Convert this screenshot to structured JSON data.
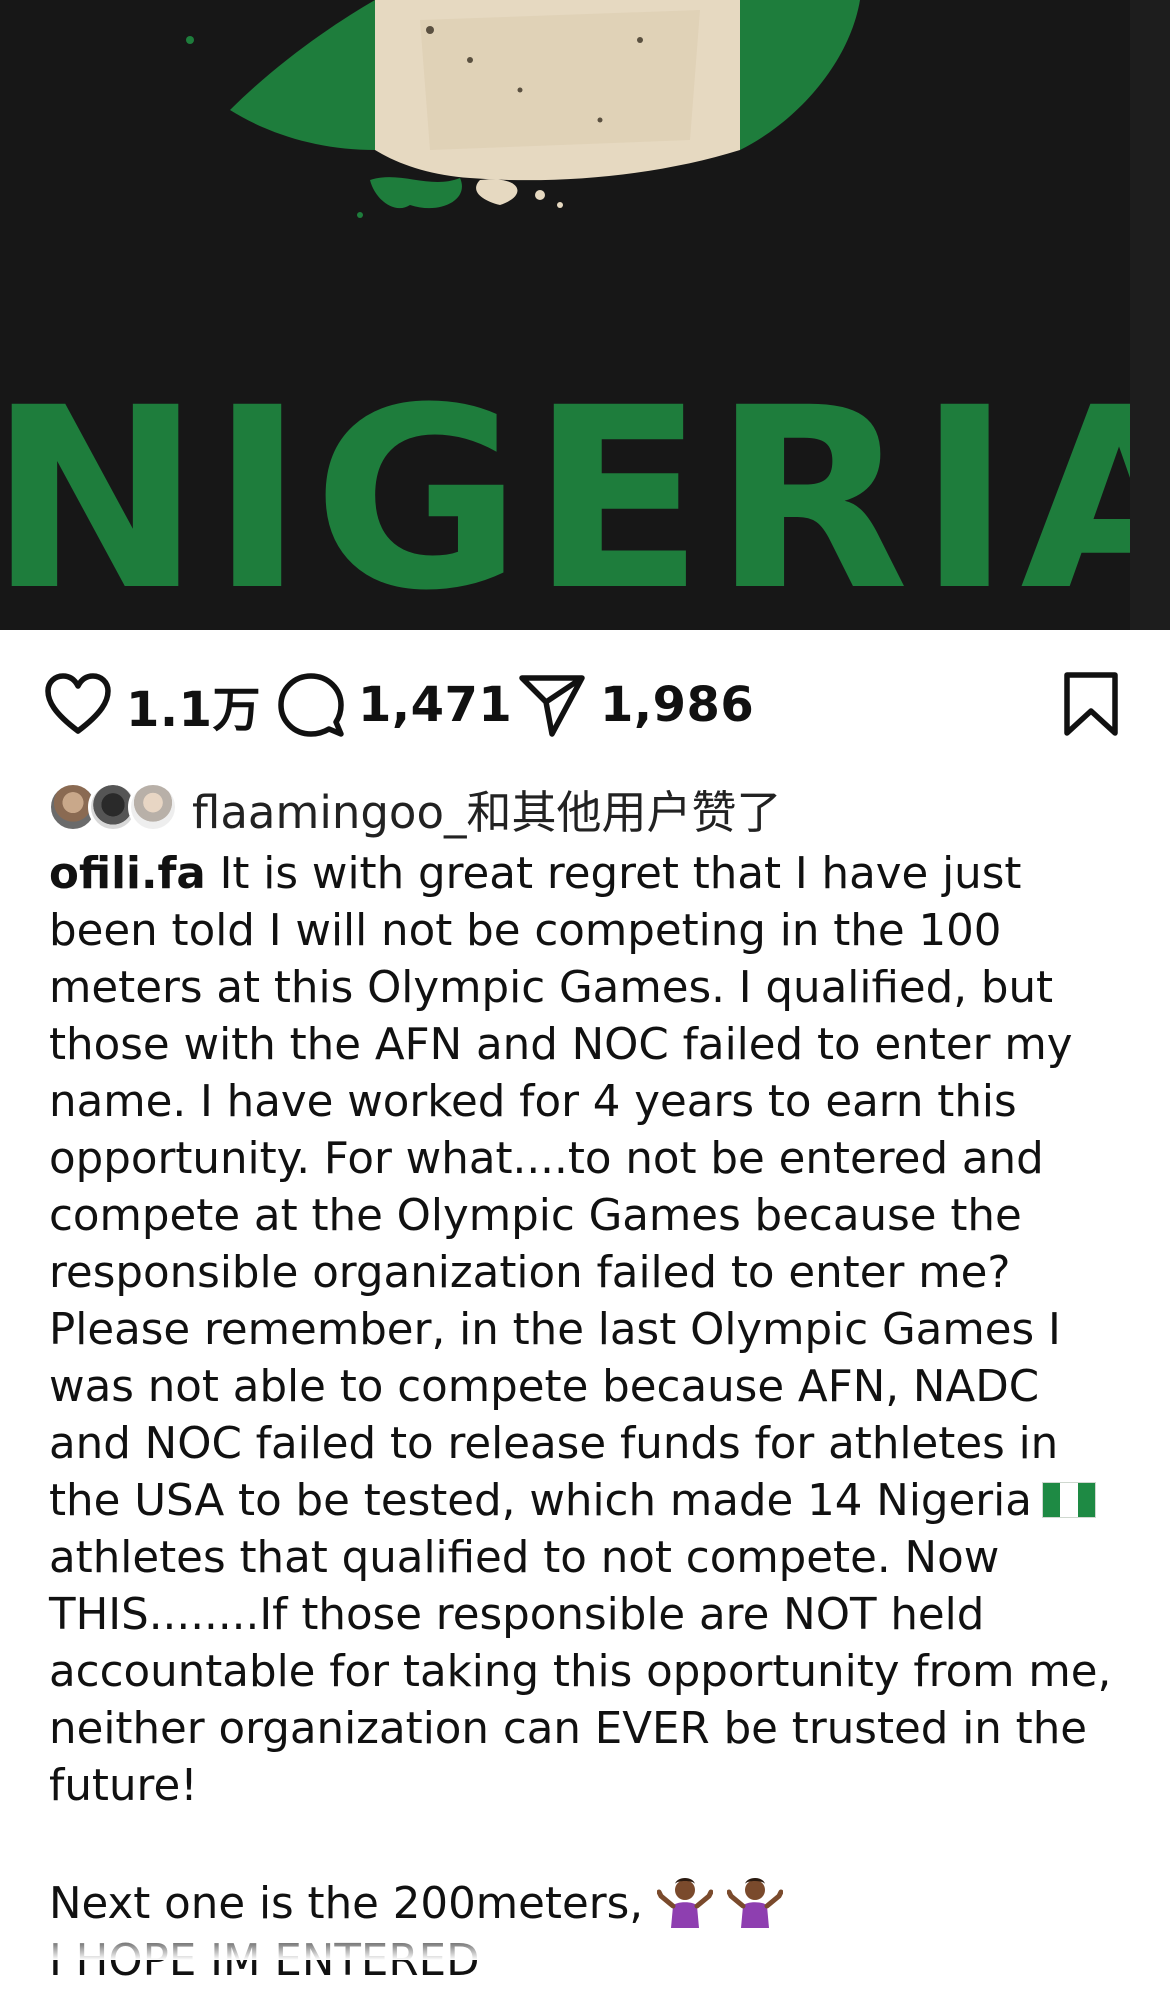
{
  "post_image": {
    "banner_text": "NIGERIA",
    "colors": {
      "green": "#1e7d3c",
      "background": "#171717",
      "paper": "#e8dcc6"
    }
  },
  "actions": {
    "like": {
      "icon": "heart-icon",
      "count": "1.1万"
    },
    "comment": {
      "icon": "comment-icon",
      "count": "1,471"
    },
    "share": {
      "icon": "send-icon",
      "count": "1,986"
    },
    "save": {
      "icon": "bookmark-icon"
    }
  },
  "liked_by": {
    "text": "flaamingoo_和其他用户赞了"
  },
  "caption": {
    "username": "ofili.fa",
    "part1": " It is with great regret that I have just been told I will not be competing in the 100 meters at this Olympic Games. I qualified, but those with the AFN and NOC failed to enter my name. I have worked for 4 years to earn this opportunity. For what....to not be entered and compete at the Olympic Games because the responsible organization failed to enter me?  Please remember, in the last Olympic Games I was not able to compete because AFN, NADC and NOC failed to release funds for athletes in the USA to be tested, which made 14 Nigeria",
    "flag_emoji": "nigeria-flag-icon",
    "part2": " athletes that qualified to not compete. Now THIS........If those responsible are NOT held accountable for taking this opportunity from me, neither organization can EVER be trusted in the future!",
    "line_next": "Next one is the 200meters,",
    "shrug_emoji": "person-shrugging-icon",
    "line_last": "I HOPE IM ENTERED"
  }
}
